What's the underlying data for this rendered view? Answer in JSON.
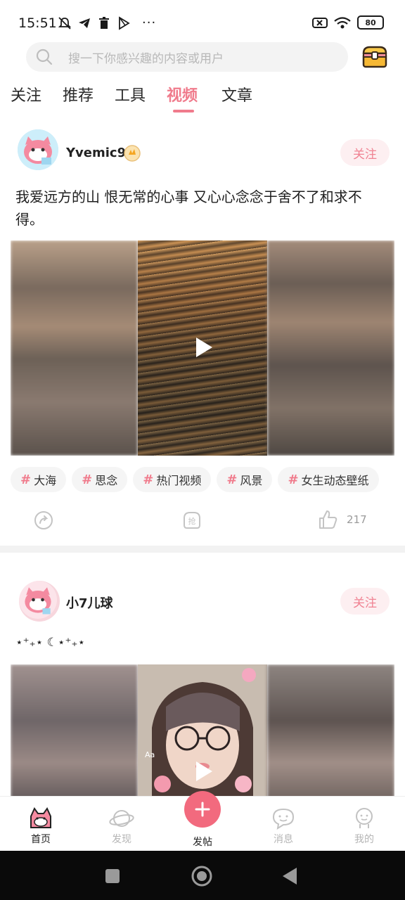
{
  "status_bar": {
    "time": "15:51",
    "dots": "···",
    "battery": "80"
  },
  "search": {
    "placeholder": "搜一下你感兴趣的内容或用户"
  },
  "tabs": [
    {
      "label": "关注"
    },
    {
      "label": "推荐"
    },
    {
      "label": "工具"
    },
    {
      "label": "视频"
    },
    {
      "label": "文章"
    }
  ],
  "posts": [
    {
      "username": "Yvemic9.",
      "follow_label": "关注",
      "text": "我爱远方的山 恨无常的心事 又心心念念于舍不了和求不得。",
      "tags": [
        "大海",
        "思念",
        "热门视频",
        "风景",
        "女生动态壁纸"
      ],
      "like_count": "217",
      "grab_label": "抢"
    },
    {
      "username": "小7儿球",
      "follow_label": "关注",
      "text": "⋆⁺₊⋆ ☾⋆⁺₊⋆"
    }
  ],
  "bottom_nav": [
    {
      "label": "首页"
    },
    {
      "label": "发现"
    },
    {
      "label": "发帖"
    },
    {
      "label": "消息"
    },
    {
      "label": "我的"
    }
  ],
  "colors": {
    "accent": "#f07b8c",
    "fab": "#f26a7e"
  }
}
